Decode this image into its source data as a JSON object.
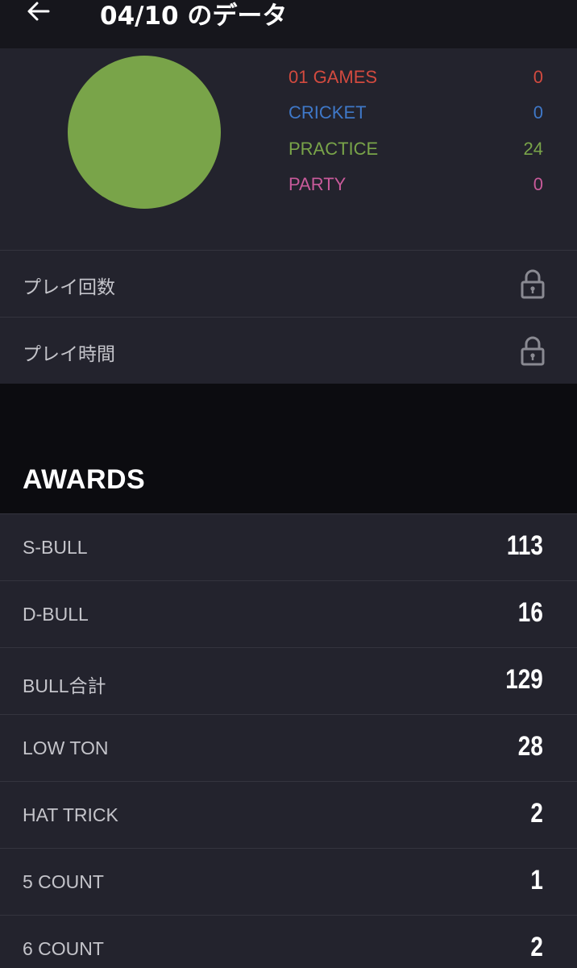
{
  "header": {
    "title": "04/10 のデータ",
    "back_icon": "arrow-left-icon"
  },
  "summary": {
    "pie_color": "#79a449",
    "categories": [
      {
        "label": "01 GAMES",
        "value": "0",
        "color": "#d24a3f"
      },
      {
        "label": "CRICKET",
        "value": "0",
        "color": "#3f78c8"
      },
      {
        "label": "PRACTICE",
        "value": "24",
        "color": "#79a449"
      },
      {
        "label": "PARTY",
        "value": "0",
        "color": "#c85a9a"
      }
    ]
  },
  "locked_rows": [
    {
      "label": "プレイ回数",
      "icon": "lock-icon"
    },
    {
      "label": "プレイ時間",
      "icon": "lock-icon"
    }
  ],
  "awards": {
    "title": "AWARDS",
    "items": [
      {
        "label": "S-BULL",
        "value": "113"
      },
      {
        "label": "D-BULL",
        "value": "16"
      },
      {
        "label": "BULL合計",
        "value": "129"
      },
      {
        "label": "LOW TON",
        "value": "28"
      },
      {
        "label": "HAT TRICK",
        "value": "2"
      },
      {
        "label": "5 COUNT",
        "value": "1"
      },
      {
        "label": "6 COUNT",
        "value": "2"
      }
    ]
  }
}
